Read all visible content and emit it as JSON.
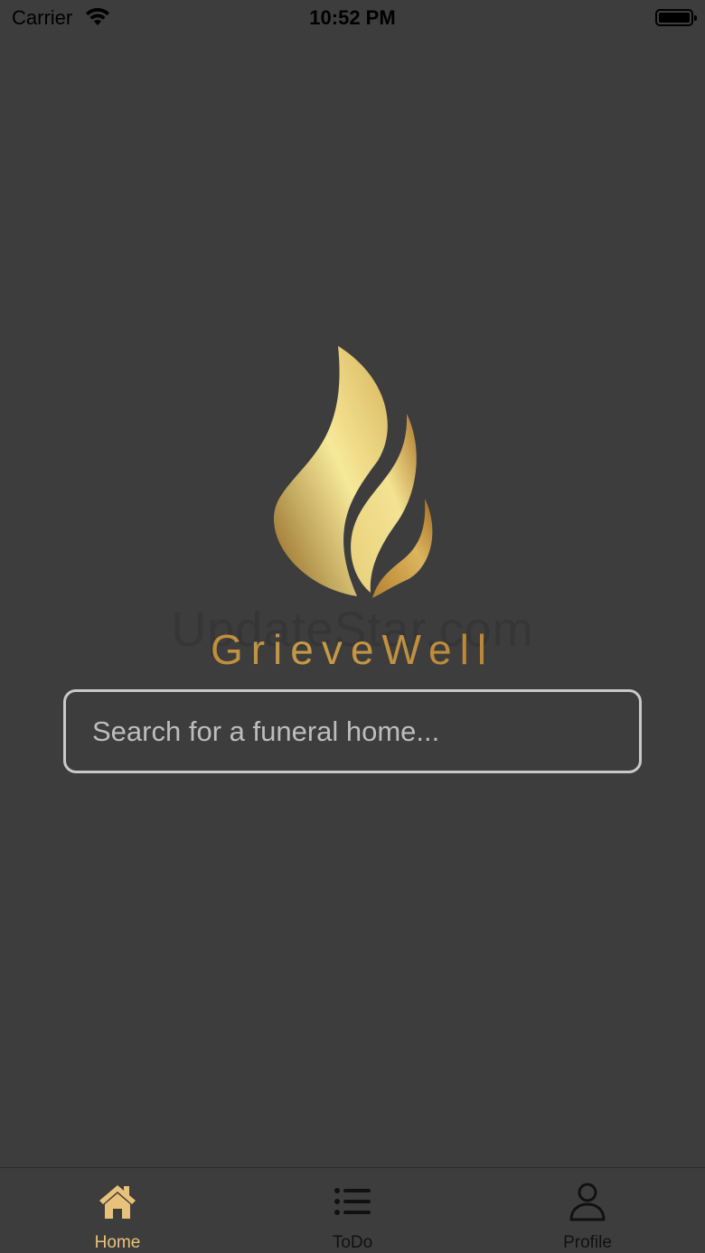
{
  "status_bar": {
    "carrier": "Carrier",
    "time": "10:52 PM",
    "wifi_icon": "wifi-icon",
    "battery_icon": "battery-icon"
  },
  "logo": {
    "icon": "flame-logo-icon",
    "brand_name": "GrieveWell",
    "watermark": "UpdateStar.com",
    "gold_colors": [
      "#8f6521",
      "#f6e99a",
      "#b07a2c"
    ]
  },
  "search": {
    "value": "",
    "placeholder": "Search for a funeral home..."
  },
  "tab_bar": {
    "active_color": "#e8c27a",
    "tabs": [
      {
        "label": "Home",
        "icon": "home-icon",
        "active": true
      },
      {
        "label": "ToDo",
        "icon": "list-icon",
        "active": false
      },
      {
        "label": "Profile",
        "icon": "person-icon",
        "active": false
      }
    ]
  }
}
